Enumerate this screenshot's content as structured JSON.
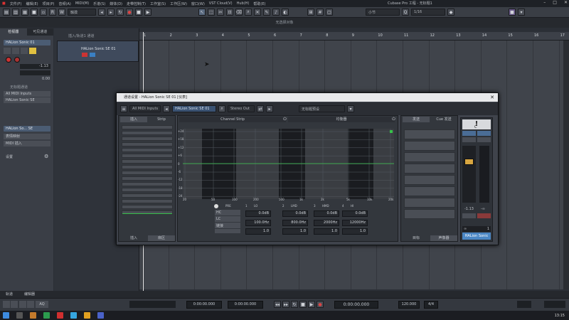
{
  "app": {
    "menus": [
      "文件(F)",
      "编辑(E)",
      "项目(P)",
      "音频(A)",
      "MIDI(M)",
      "乐谱(S)",
      "媒体(D)",
      "走带控制(T)",
      "工作室(S)",
      "工作区(W)",
      "窗口(W)",
      "VST Cloud(V)",
      "Hub(H)",
      "帮助(E)"
    ],
    "window_title": "Cubase Pro 工程 - 无标题1",
    "win_controls": [
      "–",
      "□",
      "✕"
    ],
    "status_text": "无选择对象",
    "toolbar": {
      "mode": "触摸",
      "grid_type": "小节",
      "quantize": "1/16"
    }
  },
  "inspector": {
    "tabs": [
      "检视器",
      "可见通道"
    ],
    "track_name": "HALion Sonic  01",
    "volume": "-1.13",
    "pan": "0.00",
    "input": "All MIDI Inputs",
    "output": "HALion Sonic SE",
    "routing_label": "无标题通道",
    "sections": [
      "HALion So... SE",
      "表情映射",
      "MIDI 插入",
      "设置"
    ],
    "bottom_tabs": [
      "轨道",
      "编辑器"
    ]
  },
  "tracklist": {
    "header": "插入/轨道1 通道",
    "track_name": "HALion Sonic SE 01"
  },
  "ruler": {
    "bars": [
      "1",
      "2",
      "3",
      "4",
      "5",
      "6",
      "7",
      "8",
      "9",
      "10",
      "11",
      "12",
      "13",
      "14",
      "15",
      "16",
      "17"
    ]
  },
  "channel_window": {
    "title": "通道设置 - HALion Sonic SE 01 [仪表]",
    "input_routing": "All MIDI Inputs",
    "channel_name": "HALion Sonic SE 01",
    "output_routing": "Stereo Out",
    "preset": "无标题预设",
    "left_tabs": [
      "插入",
      "Strip"
    ],
    "left_bottom_tabs": [
      "插入",
      "扇区"
    ],
    "center_tabs": [
      "Channel Strip",
      "均衡器"
    ],
    "right_tabs": [
      "发送",
      "Cue 发送"
    ],
    "right_bottom_tabs": [
      "目标",
      "声像器"
    ],
    "eq_y_ticks": [
      "+24",
      "+18",
      "+12",
      "+6",
      "0",
      "-6",
      "-12",
      "-18",
      "-24"
    ],
    "eq_x_ticks": [
      "20",
      "50",
      "100",
      "200",
      "500",
      "1k",
      "2k",
      "5k",
      "10k",
      "20k"
    ],
    "eq_filter": {
      "hc": "HC",
      "lc": "LC",
      "link": "链接"
    },
    "eq_bands": [
      {
        "num": "1",
        "type": "LO",
        "gain": "0.0dB",
        "freq": "100.0Hz",
        "q": "1.0"
      },
      {
        "num": "2",
        "type": "LMD",
        "gain": "0.0dB",
        "freq": "800.0Hz",
        "q": "1.0"
      },
      {
        "num": "3",
        "type": "HMD",
        "gain": "0.0dB",
        "freq": "2000Hz",
        "q": "1.0"
      },
      {
        "num": "4",
        "type": "HI",
        "gain": "0.0dB",
        "freq": "12000Hz",
        "q": "1.0"
      }
    ],
    "fader_value": "-1.13",
    "fader_left": "-∞",
    "channel_num": "1",
    "channel_label": "HALion Sonic SE",
    "pan_value": "C"
  },
  "transport": {
    "position_left": "0:00:00.000",
    "position_right": "0:00:00.000",
    "main_time": "0:00:00.000",
    "tempo": "120.000",
    "signature": "4/4"
  },
  "taskbar": {
    "clock": "13:15"
  },
  "colors": {
    "accent": "#4b87c4",
    "eq_curve": "#36c24a",
    "record": "#d33"
  }
}
